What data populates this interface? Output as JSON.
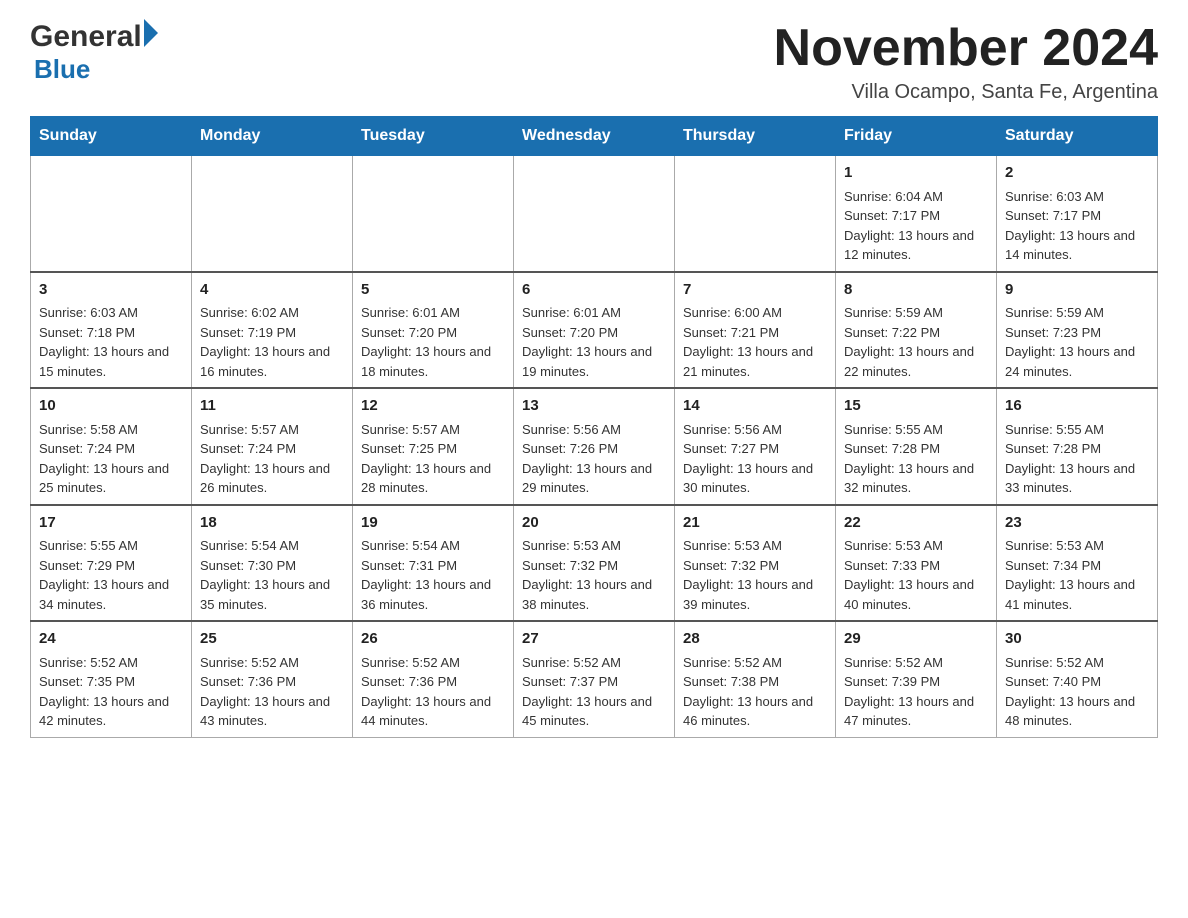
{
  "header": {
    "logo_general": "General",
    "logo_blue": "Blue",
    "month_title": "November 2024",
    "location": "Villa Ocampo, Santa Fe, Argentina"
  },
  "weekdays": [
    "Sunday",
    "Monday",
    "Tuesday",
    "Wednesday",
    "Thursday",
    "Friday",
    "Saturday"
  ],
  "weeks": [
    [
      {
        "day": "",
        "info": ""
      },
      {
        "day": "",
        "info": ""
      },
      {
        "day": "",
        "info": ""
      },
      {
        "day": "",
        "info": ""
      },
      {
        "day": "",
        "info": ""
      },
      {
        "day": "1",
        "info": "Sunrise: 6:04 AM\nSunset: 7:17 PM\nDaylight: 13 hours and 12 minutes."
      },
      {
        "day": "2",
        "info": "Sunrise: 6:03 AM\nSunset: 7:17 PM\nDaylight: 13 hours and 14 minutes."
      }
    ],
    [
      {
        "day": "3",
        "info": "Sunrise: 6:03 AM\nSunset: 7:18 PM\nDaylight: 13 hours and 15 minutes."
      },
      {
        "day": "4",
        "info": "Sunrise: 6:02 AM\nSunset: 7:19 PM\nDaylight: 13 hours and 16 minutes."
      },
      {
        "day": "5",
        "info": "Sunrise: 6:01 AM\nSunset: 7:20 PM\nDaylight: 13 hours and 18 minutes."
      },
      {
        "day": "6",
        "info": "Sunrise: 6:01 AM\nSunset: 7:20 PM\nDaylight: 13 hours and 19 minutes."
      },
      {
        "day": "7",
        "info": "Sunrise: 6:00 AM\nSunset: 7:21 PM\nDaylight: 13 hours and 21 minutes."
      },
      {
        "day": "8",
        "info": "Sunrise: 5:59 AM\nSunset: 7:22 PM\nDaylight: 13 hours and 22 minutes."
      },
      {
        "day": "9",
        "info": "Sunrise: 5:59 AM\nSunset: 7:23 PM\nDaylight: 13 hours and 24 minutes."
      }
    ],
    [
      {
        "day": "10",
        "info": "Sunrise: 5:58 AM\nSunset: 7:24 PM\nDaylight: 13 hours and 25 minutes."
      },
      {
        "day": "11",
        "info": "Sunrise: 5:57 AM\nSunset: 7:24 PM\nDaylight: 13 hours and 26 minutes."
      },
      {
        "day": "12",
        "info": "Sunrise: 5:57 AM\nSunset: 7:25 PM\nDaylight: 13 hours and 28 minutes."
      },
      {
        "day": "13",
        "info": "Sunrise: 5:56 AM\nSunset: 7:26 PM\nDaylight: 13 hours and 29 minutes."
      },
      {
        "day": "14",
        "info": "Sunrise: 5:56 AM\nSunset: 7:27 PM\nDaylight: 13 hours and 30 minutes."
      },
      {
        "day": "15",
        "info": "Sunrise: 5:55 AM\nSunset: 7:28 PM\nDaylight: 13 hours and 32 minutes."
      },
      {
        "day": "16",
        "info": "Sunrise: 5:55 AM\nSunset: 7:28 PM\nDaylight: 13 hours and 33 minutes."
      }
    ],
    [
      {
        "day": "17",
        "info": "Sunrise: 5:55 AM\nSunset: 7:29 PM\nDaylight: 13 hours and 34 minutes."
      },
      {
        "day": "18",
        "info": "Sunrise: 5:54 AM\nSunset: 7:30 PM\nDaylight: 13 hours and 35 minutes."
      },
      {
        "day": "19",
        "info": "Sunrise: 5:54 AM\nSunset: 7:31 PM\nDaylight: 13 hours and 36 minutes."
      },
      {
        "day": "20",
        "info": "Sunrise: 5:53 AM\nSunset: 7:32 PM\nDaylight: 13 hours and 38 minutes."
      },
      {
        "day": "21",
        "info": "Sunrise: 5:53 AM\nSunset: 7:32 PM\nDaylight: 13 hours and 39 minutes."
      },
      {
        "day": "22",
        "info": "Sunrise: 5:53 AM\nSunset: 7:33 PM\nDaylight: 13 hours and 40 minutes."
      },
      {
        "day": "23",
        "info": "Sunrise: 5:53 AM\nSunset: 7:34 PM\nDaylight: 13 hours and 41 minutes."
      }
    ],
    [
      {
        "day": "24",
        "info": "Sunrise: 5:52 AM\nSunset: 7:35 PM\nDaylight: 13 hours and 42 minutes."
      },
      {
        "day": "25",
        "info": "Sunrise: 5:52 AM\nSunset: 7:36 PM\nDaylight: 13 hours and 43 minutes."
      },
      {
        "day": "26",
        "info": "Sunrise: 5:52 AM\nSunset: 7:36 PM\nDaylight: 13 hours and 44 minutes."
      },
      {
        "day": "27",
        "info": "Sunrise: 5:52 AM\nSunset: 7:37 PM\nDaylight: 13 hours and 45 minutes."
      },
      {
        "day": "28",
        "info": "Sunrise: 5:52 AM\nSunset: 7:38 PM\nDaylight: 13 hours and 46 minutes."
      },
      {
        "day": "29",
        "info": "Sunrise: 5:52 AM\nSunset: 7:39 PM\nDaylight: 13 hours and 47 minutes."
      },
      {
        "day": "30",
        "info": "Sunrise: 5:52 AM\nSunset: 7:40 PM\nDaylight: 13 hours and 48 minutes."
      }
    ]
  ]
}
